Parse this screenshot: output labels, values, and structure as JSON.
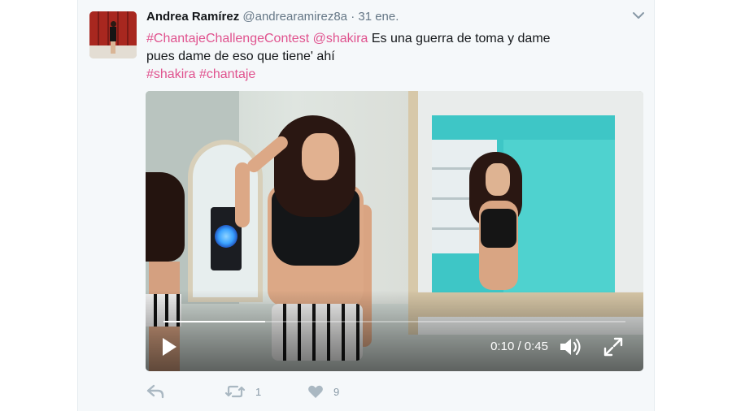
{
  "tweet": {
    "author_name": "Andrea Ramírez",
    "handle": "@andrearamirez8a",
    "separator": "·",
    "date": "31 ene.",
    "text": {
      "hashtag_main": "#ChantajeChallengeContest",
      "mention": "@shakira",
      "body_1": " Es una guerra de toma y dame",
      "body_2": "pues dame de eso que tiene' ahí",
      "hashtag_1": "#shakira",
      "hashtag_2": "#chantaje"
    }
  },
  "video": {
    "timecode": "0:10 / 0:45",
    "progress_fraction": 0.22
  },
  "actions": {
    "retweet_count": "1",
    "like_count": "9"
  },
  "colors": {
    "link": "#e0528e",
    "muted": "#657786",
    "card_bg": "#f5f8fa"
  },
  "icons": [
    "reply-icon",
    "retweet-icon",
    "heart-icon",
    "play-icon",
    "volume-icon",
    "fullscreen-icon",
    "chevron-down-icon"
  ]
}
